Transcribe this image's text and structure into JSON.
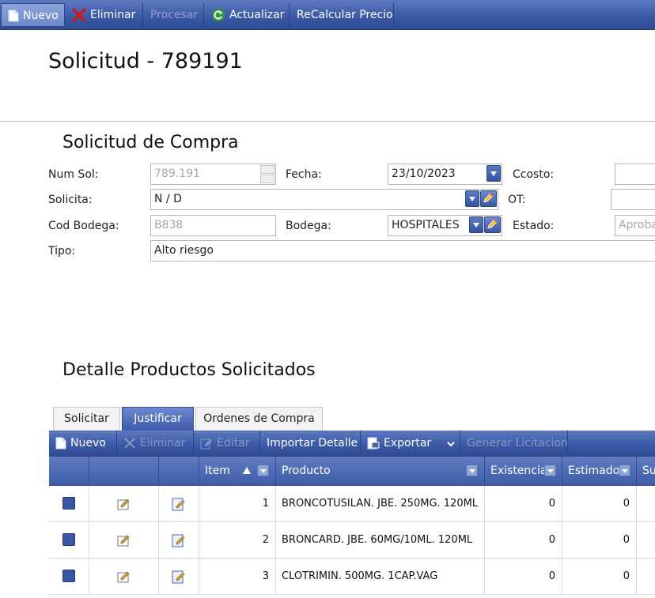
{
  "toolbar": {
    "nuevo": "Nuevo",
    "eliminar": "Eliminar",
    "procesar": "Procesar",
    "actualizar": "Actualizar",
    "recalcular": "ReCalcular Precio"
  },
  "page": {
    "title": "Solicitud - 789191"
  },
  "form": {
    "section_title": "Solicitud de Compra",
    "num_sol_label": "Num Sol:",
    "num_sol_value": "789.191",
    "fecha_label": "Fecha:",
    "fecha_value": "23/10/2023",
    "ccosto_label": "Ccosto:",
    "ccosto_value": "",
    "solicita_label": "Solicita:",
    "solicita_value": "N / D",
    "ot_label": "OT:",
    "ot_value": "",
    "cod_bodega_label": "Cod Bodega:",
    "cod_bodega_value": "B838",
    "bodega_label": "Bodega:",
    "bodega_value": "HOSPITALES",
    "estado_label": "Estado:",
    "estado_value": "Aprobad",
    "tipo_label": "Tipo:",
    "tipo_value": "Alto riesgo"
  },
  "detail": {
    "section_title": "Detalle Productos Solicitados",
    "tabs": [
      {
        "label": "Solicitar"
      },
      {
        "label": "Justificar"
      },
      {
        "label": "Ordenes de Compra"
      }
    ],
    "active_tab": "Justificar",
    "grid_toolbar": {
      "nuevo": "Nuevo",
      "eliminar": "Eliminar",
      "editar": "Editar",
      "importar": "Importar Detalle",
      "exportar": "Exportar",
      "generar": "Generar Licitacion"
    },
    "columns": {
      "item": "Item",
      "producto": "Producto",
      "existencia": "Existencia",
      "estimado": "Estimado",
      "su": "Su"
    },
    "rows": [
      {
        "item": "1",
        "producto": "BRONCOTUSILAN. JBE. 250MG. 120ML",
        "existencia": "0",
        "estimado": "0"
      },
      {
        "item": "2",
        "producto": "BRONCARD. JBE. 60MG/10ML. 120ML",
        "existencia": "0",
        "estimado": "0"
      },
      {
        "item": "3",
        "producto": "CLOTRIMIN. 500MG. 1CAP.VAG",
        "existencia": "0",
        "estimado": "0"
      }
    ]
  },
  "colors": {
    "accent": "#3c5aa8",
    "toolbar_dark": "#2f4b93"
  },
  "icons": [
    "document-icon",
    "delete-x-icon",
    "refresh-icon",
    "spin-up-icon",
    "spin-down-icon",
    "dropdown-arrow-icon",
    "edit-pencil-icon",
    "export-icon",
    "sort-asc-icon",
    "column-menu-icon",
    "row-checkbox-icon",
    "edit-row-icon",
    "edit-form-icon"
  ]
}
